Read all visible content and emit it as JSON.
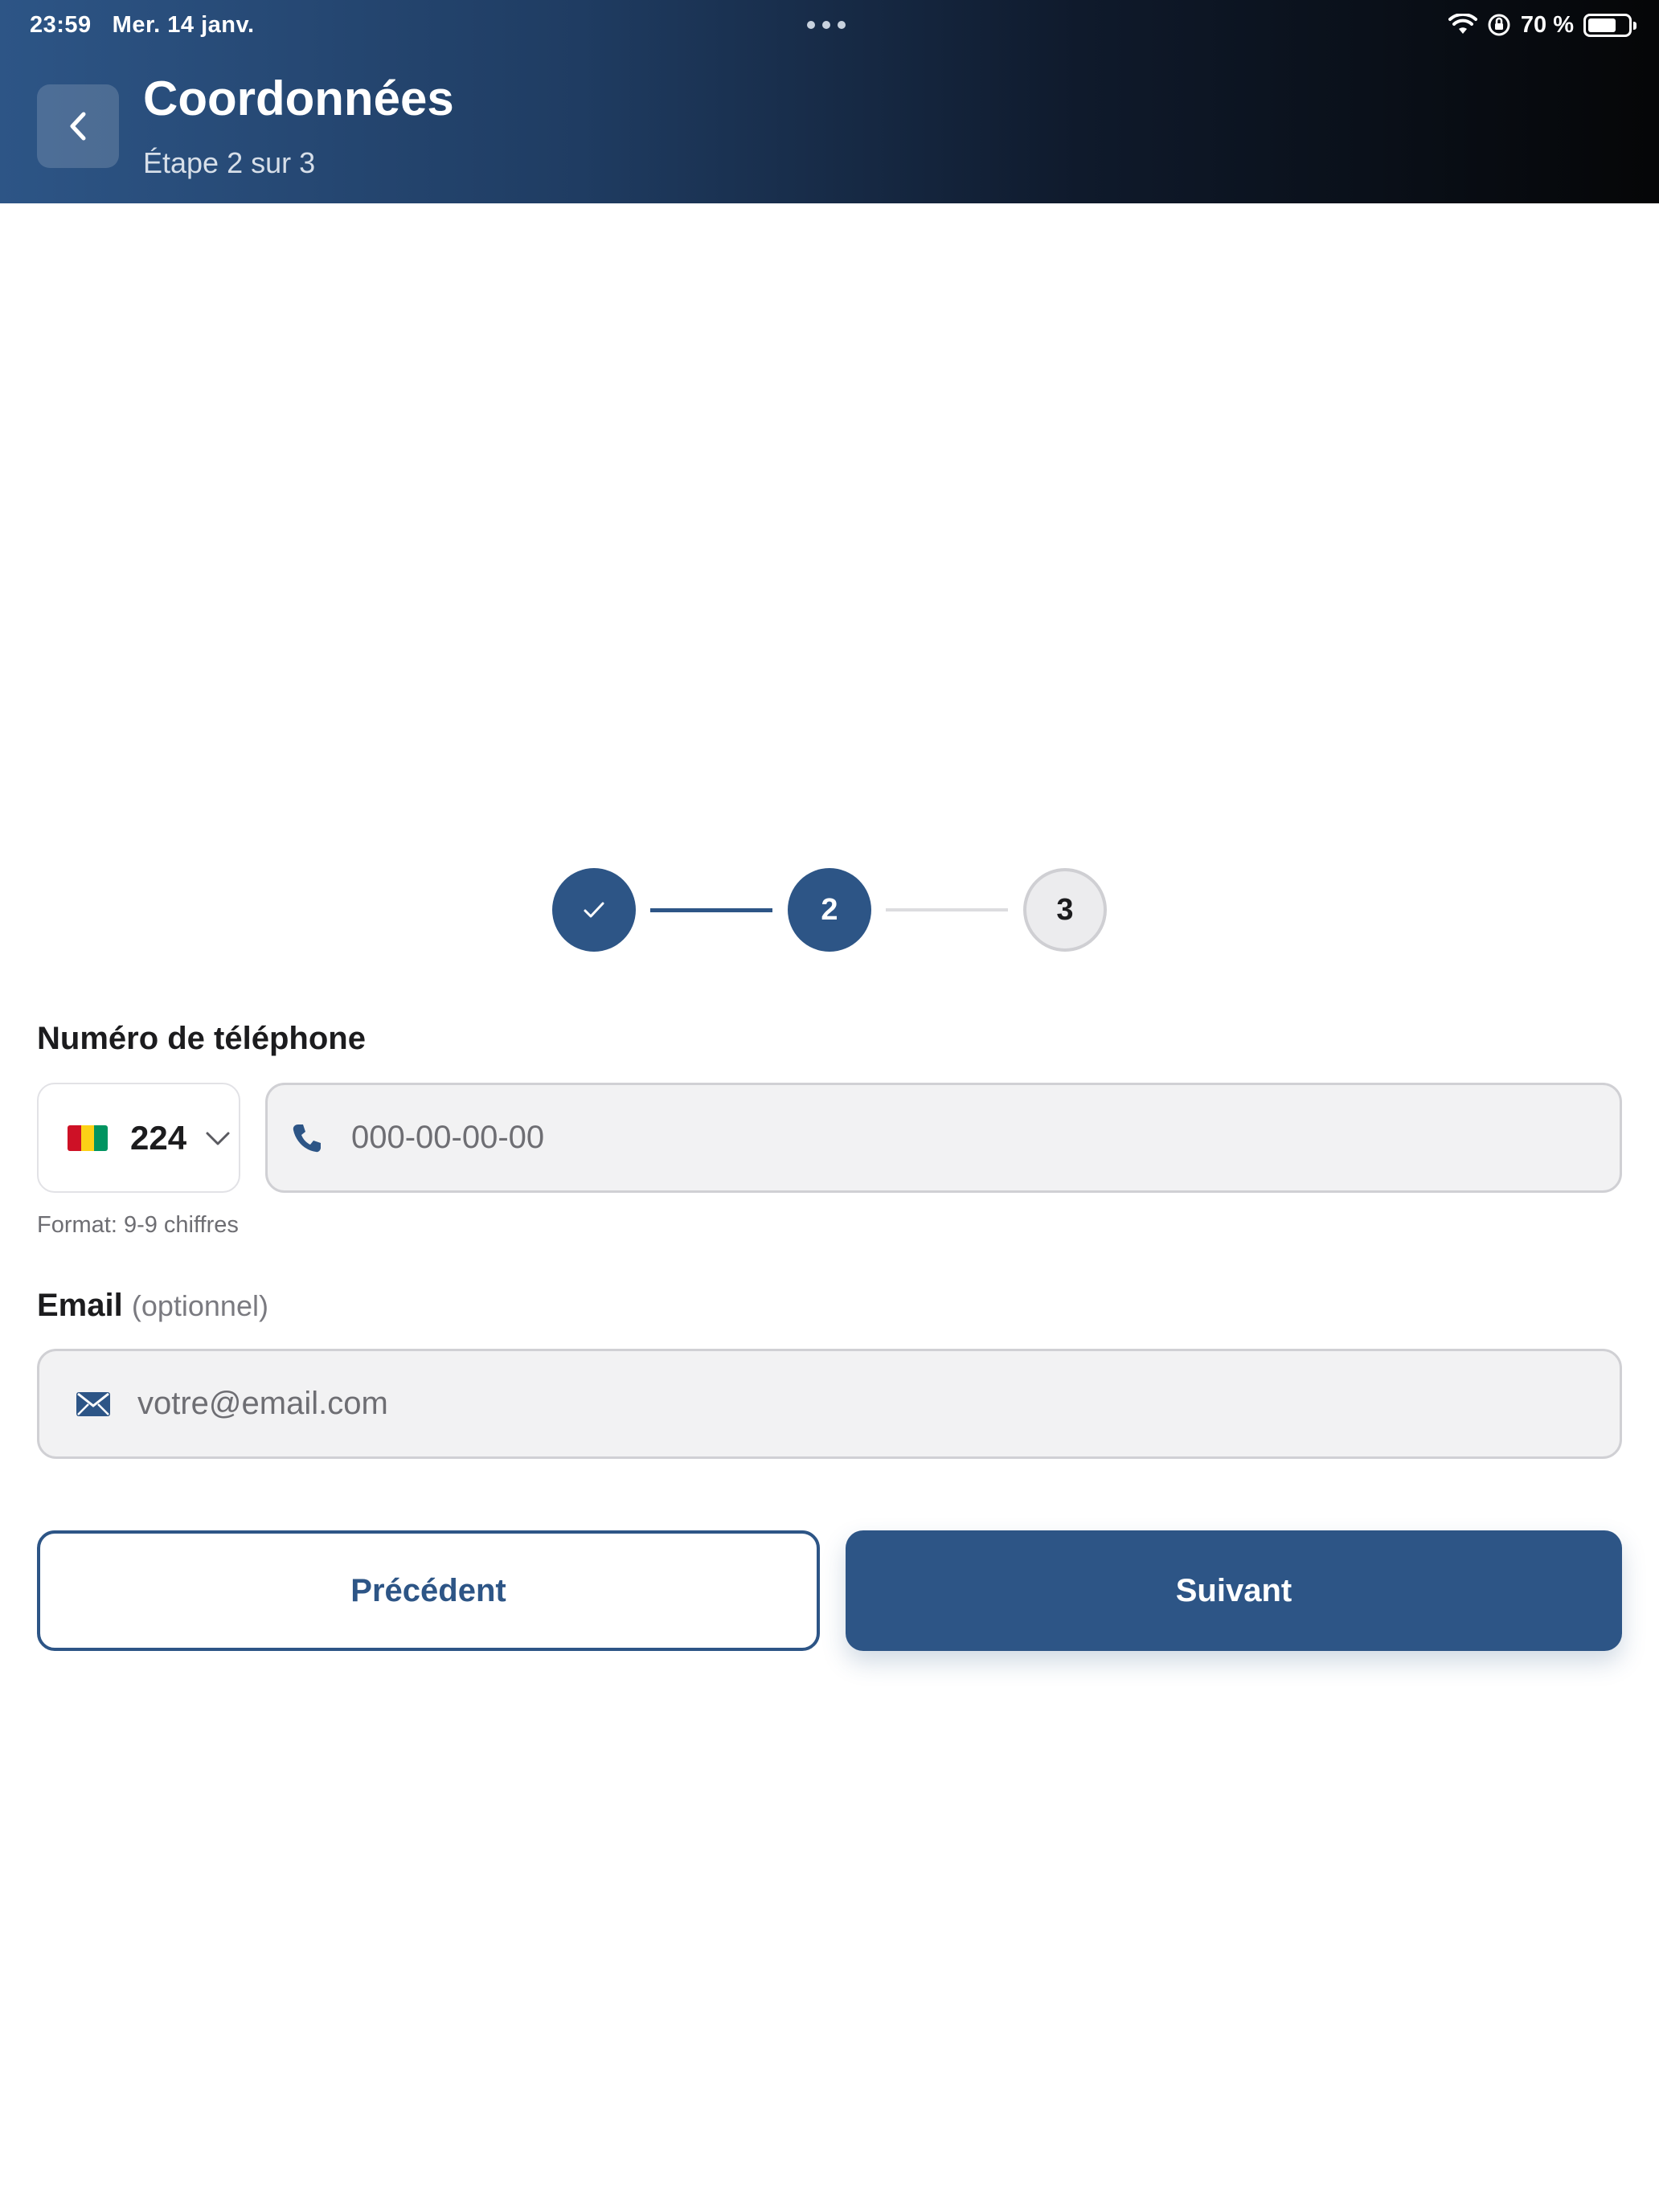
{
  "status_bar": {
    "time": "23:59",
    "date": "Mer. 14 janv.",
    "battery": "70 %",
    "battery_level": 0.7
  },
  "header": {
    "title": "Coordonnées",
    "subtitle": "Étape 2 sur 3"
  },
  "stepper": {
    "current": 2,
    "total": 3,
    "steps": [
      "✓",
      "2",
      "3"
    ]
  },
  "phone": {
    "label": "Numéro de téléphone",
    "country_code": "224",
    "placeholder": "000-00-00-00",
    "hint": "Format: 9-9 chiffres"
  },
  "email": {
    "label": "Email",
    "optional": "(optionnel)",
    "placeholder": "votre@email.com"
  },
  "buttons": {
    "previous": "Précédent",
    "next": "Suivant"
  },
  "colors": {
    "primary": "#2d5586",
    "flag_red": "#ce1126",
    "flag_yellow": "#fcd116",
    "flag_green": "#009460"
  }
}
